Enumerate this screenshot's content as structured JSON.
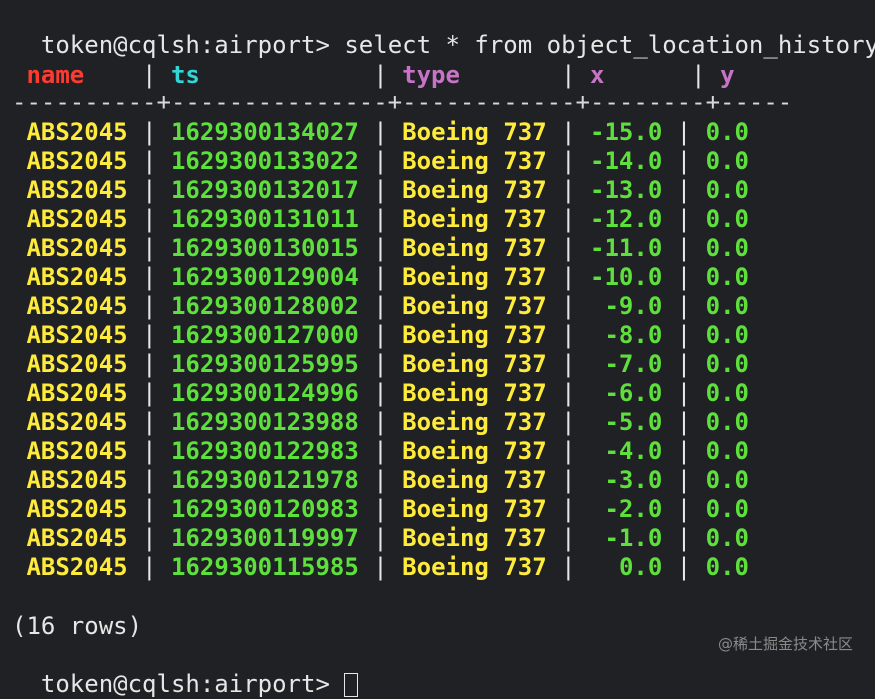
{
  "terminal": {
    "prompt": "token@cqlsh:airport> ",
    "command": "select * from object_location_history;",
    "columns": [
      "name",
      "ts",
      "type",
      "x",
      "y"
    ],
    "separator": "----------+---------------+------------+--------+-----",
    "rows": [
      {
        "name": "ABS2045",
        "ts": "1629300134027",
        "type": "Boeing 737",
        "x": "-15.0",
        "y": "0.0"
      },
      {
        "name": "ABS2045",
        "ts": "1629300133022",
        "type": "Boeing 737",
        "x": "-14.0",
        "y": "0.0"
      },
      {
        "name": "ABS2045",
        "ts": "1629300132017",
        "type": "Boeing 737",
        "x": "-13.0",
        "y": "0.0"
      },
      {
        "name": "ABS2045",
        "ts": "1629300131011",
        "type": "Boeing 737",
        "x": "-12.0",
        "y": "0.0"
      },
      {
        "name": "ABS2045",
        "ts": "1629300130015",
        "type": "Boeing 737",
        "x": "-11.0",
        "y": "0.0"
      },
      {
        "name": "ABS2045",
        "ts": "1629300129004",
        "type": "Boeing 737",
        "x": "-10.0",
        "y": "0.0"
      },
      {
        "name": "ABS2045",
        "ts": "1629300128002",
        "type": "Boeing 737",
        "x": "-9.0",
        "y": "0.0"
      },
      {
        "name": "ABS2045",
        "ts": "1629300127000",
        "type": "Boeing 737",
        "x": "-8.0",
        "y": "0.0"
      },
      {
        "name": "ABS2045",
        "ts": "1629300125995",
        "type": "Boeing 737",
        "x": "-7.0",
        "y": "0.0"
      },
      {
        "name": "ABS2045",
        "ts": "1629300124996",
        "type": "Boeing 737",
        "x": "-6.0",
        "y": "0.0"
      },
      {
        "name": "ABS2045",
        "ts": "1629300123988",
        "type": "Boeing 737",
        "x": "-5.0",
        "y": "0.0"
      },
      {
        "name": "ABS2045",
        "ts": "1629300122983",
        "type": "Boeing 737",
        "x": "-4.0",
        "y": "0.0"
      },
      {
        "name": "ABS2045",
        "ts": "1629300121978",
        "type": "Boeing 737",
        "x": "-3.0",
        "y": "0.0"
      },
      {
        "name": "ABS2045",
        "ts": "1629300120983",
        "type": "Boeing 737",
        "x": "-2.0",
        "y": "0.0"
      },
      {
        "name": "ABS2045",
        "ts": "1629300119997",
        "type": "Boeing 737",
        "x": "-1.0",
        "y": "0.0"
      },
      {
        "name": "ABS2045",
        "ts": "1629300115985",
        "type": "Boeing 737",
        "x": "0.0",
        "y": "0.0"
      }
    ],
    "rows_count": "(16 rows)",
    "watermark": "@稀土掘金技术社区"
  },
  "colors": {
    "background": "#202124",
    "header_name": "#ff3b30",
    "header_ts": "#33d6d6",
    "header_other": "#c873c8",
    "value_text": "#ffeb3b",
    "value_number": "#5ee03c"
  }
}
